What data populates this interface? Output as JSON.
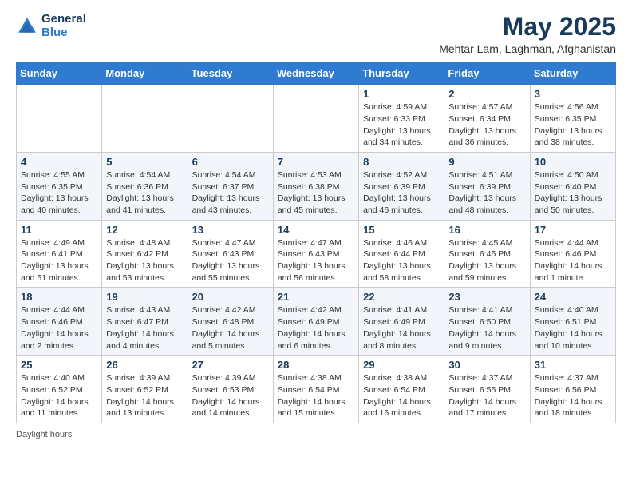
{
  "header": {
    "logo_general": "General",
    "logo_blue": "Blue",
    "title": "May 2025",
    "subtitle": "Mehtar Lam, Laghman, Afghanistan"
  },
  "columns": [
    "Sunday",
    "Monday",
    "Tuesday",
    "Wednesday",
    "Thursday",
    "Friday",
    "Saturday"
  ],
  "weeks": [
    [
      {
        "day": "",
        "info": ""
      },
      {
        "day": "",
        "info": ""
      },
      {
        "day": "",
        "info": ""
      },
      {
        "day": "",
        "info": ""
      },
      {
        "day": "1",
        "info": "Sunrise: 4:59 AM\nSunset: 6:33 PM\nDaylight: 13 hours\nand 34 minutes."
      },
      {
        "day": "2",
        "info": "Sunrise: 4:57 AM\nSunset: 6:34 PM\nDaylight: 13 hours\nand 36 minutes."
      },
      {
        "day": "3",
        "info": "Sunrise: 4:56 AM\nSunset: 6:35 PM\nDaylight: 13 hours\nand 38 minutes."
      }
    ],
    [
      {
        "day": "4",
        "info": "Sunrise: 4:55 AM\nSunset: 6:35 PM\nDaylight: 13 hours\nand 40 minutes."
      },
      {
        "day": "5",
        "info": "Sunrise: 4:54 AM\nSunset: 6:36 PM\nDaylight: 13 hours\nand 41 minutes."
      },
      {
        "day": "6",
        "info": "Sunrise: 4:54 AM\nSunset: 6:37 PM\nDaylight: 13 hours\nand 43 minutes."
      },
      {
        "day": "7",
        "info": "Sunrise: 4:53 AM\nSunset: 6:38 PM\nDaylight: 13 hours\nand 45 minutes."
      },
      {
        "day": "8",
        "info": "Sunrise: 4:52 AM\nSunset: 6:39 PM\nDaylight: 13 hours\nand 46 minutes."
      },
      {
        "day": "9",
        "info": "Sunrise: 4:51 AM\nSunset: 6:39 PM\nDaylight: 13 hours\nand 48 minutes."
      },
      {
        "day": "10",
        "info": "Sunrise: 4:50 AM\nSunset: 6:40 PM\nDaylight: 13 hours\nand 50 minutes."
      }
    ],
    [
      {
        "day": "11",
        "info": "Sunrise: 4:49 AM\nSunset: 6:41 PM\nDaylight: 13 hours\nand 51 minutes."
      },
      {
        "day": "12",
        "info": "Sunrise: 4:48 AM\nSunset: 6:42 PM\nDaylight: 13 hours\nand 53 minutes."
      },
      {
        "day": "13",
        "info": "Sunrise: 4:47 AM\nSunset: 6:43 PM\nDaylight: 13 hours\nand 55 minutes."
      },
      {
        "day": "14",
        "info": "Sunrise: 4:47 AM\nSunset: 6:43 PM\nDaylight: 13 hours\nand 56 minutes."
      },
      {
        "day": "15",
        "info": "Sunrise: 4:46 AM\nSunset: 6:44 PM\nDaylight: 13 hours\nand 58 minutes."
      },
      {
        "day": "16",
        "info": "Sunrise: 4:45 AM\nSunset: 6:45 PM\nDaylight: 13 hours\nand 59 minutes."
      },
      {
        "day": "17",
        "info": "Sunrise: 4:44 AM\nSunset: 6:46 PM\nDaylight: 14 hours\nand 1 minute."
      }
    ],
    [
      {
        "day": "18",
        "info": "Sunrise: 4:44 AM\nSunset: 6:46 PM\nDaylight: 14 hours\nand 2 minutes."
      },
      {
        "day": "19",
        "info": "Sunrise: 4:43 AM\nSunset: 6:47 PM\nDaylight: 14 hours\nand 4 minutes."
      },
      {
        "day": "20",
        "info": "Sunrise: 4:42 AM\nSunset: 6:48 PM\nDaylight: 14 hours\nand 5 minutes."
      },
      {
        "day": "21",
        "info": "Sunrise: 4:42 AM\nSunset: 6:49 PM\nDaylight: 14 hours\nand 6 minutes."
      },
      {
        "day": "22",
        "info": "Sunrise: 4:41 AM\nSunset: 6:49 PM\nDaylight: 14 hours\nand 8 minutes."
      },
      {
        "day": "23",
        "info": "Sunrise: 4:41 AM\nSunset: 6:50 PM\nDaylight: 14 hours\nand 9 minutes."
      },
      {
        "day": "24",
        "info": "Sunrise: 4:40 AM\nSunset: 6:51 PM\nDaylight: 14 hours\nand 10 minutes."
      }
    ],
    [
      {
        "day": "25",
        "info": "Sunrise: 4:40 AM\nSunset: 6:52 PM\nDaylight: 14 hours\nand 11 minutes."
      },
      {
        "day": "26",
        "info": "Sunrise: 4:39 AM\nSunset: 6:52 PM\nDaylight: 14 hours\nand 13 minutes."
      },
      {
        "day": "27",
        "info": "Sunrise: 4:39 AM\nSunset: 6:53 PM\nDaylight: 14 hours\nand 14 minutes."
      },
      {
        "day": "28",
        "info": "Sunrise: 4:38 AM\nSunset: 6:54 PM\nDaylight: 14 hours\nand 15 minutes."
      },
      {
        "day": "29",
        "info": "Sunrise: 4:38 AM\nSunset: 6:54 PM\nDaylight: 14 hours\nand 16 minutes."
      },
      {
        "day": "30",
        "info": "Sunrise: 4:37 AM\nSunset: 6:55 PM\nDaylight: 14 hours\nand 17 minutes."
      },
      {
        "day": "31",
        "info": "Sunrise: 4:37 AM\nSunset: 6:56 PM\nDaylight: 14 hours\nand 18 minutes."
      }
    ]
  ],
  "footer": {
    "note": "Daylight hours"
  }
}
